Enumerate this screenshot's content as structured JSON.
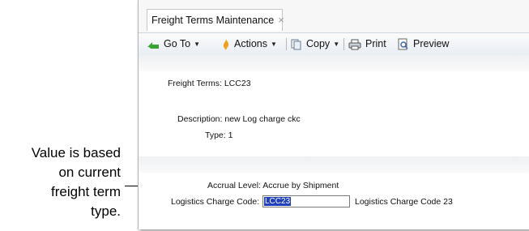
{
  "callout": {
    "lines": [
      "Value is based",
      "on current",
      "freight term",
      "type."
    ]
  },
  "tab": {
    "title": "Freight Terms Maintenance",
    "close": "×"
  },
  "toolbar": {
    "goto": "Go To",
    "actions": "Actions",
    "copy": "Copy",
    "print": "Print",
    "preview": "Preview"
  },
  "form": {
    "freight_terms_label": "Freight Terms:",
    "freight_terms_value": "LCC23",
    "description_label": "Description:",
    "description_value": "new Log charge ckc",
    "type_label": "Type:",
    "type_value": "1",
    "accrual_label": "Accrual Level:",
    "accrual_value": "Accrue by Shipment",
    "logistics_label": "Logistics Charge Code:",
    "logistics_value": "LCC23",
    "logistics_desc": "Logistics Charge Code 23"
  },
  "colors": {
    "selection": "#1f3fbf",
    "goto_arrow": "#3aa336",
    "actions_icon": "#f0a020"
  }
}
